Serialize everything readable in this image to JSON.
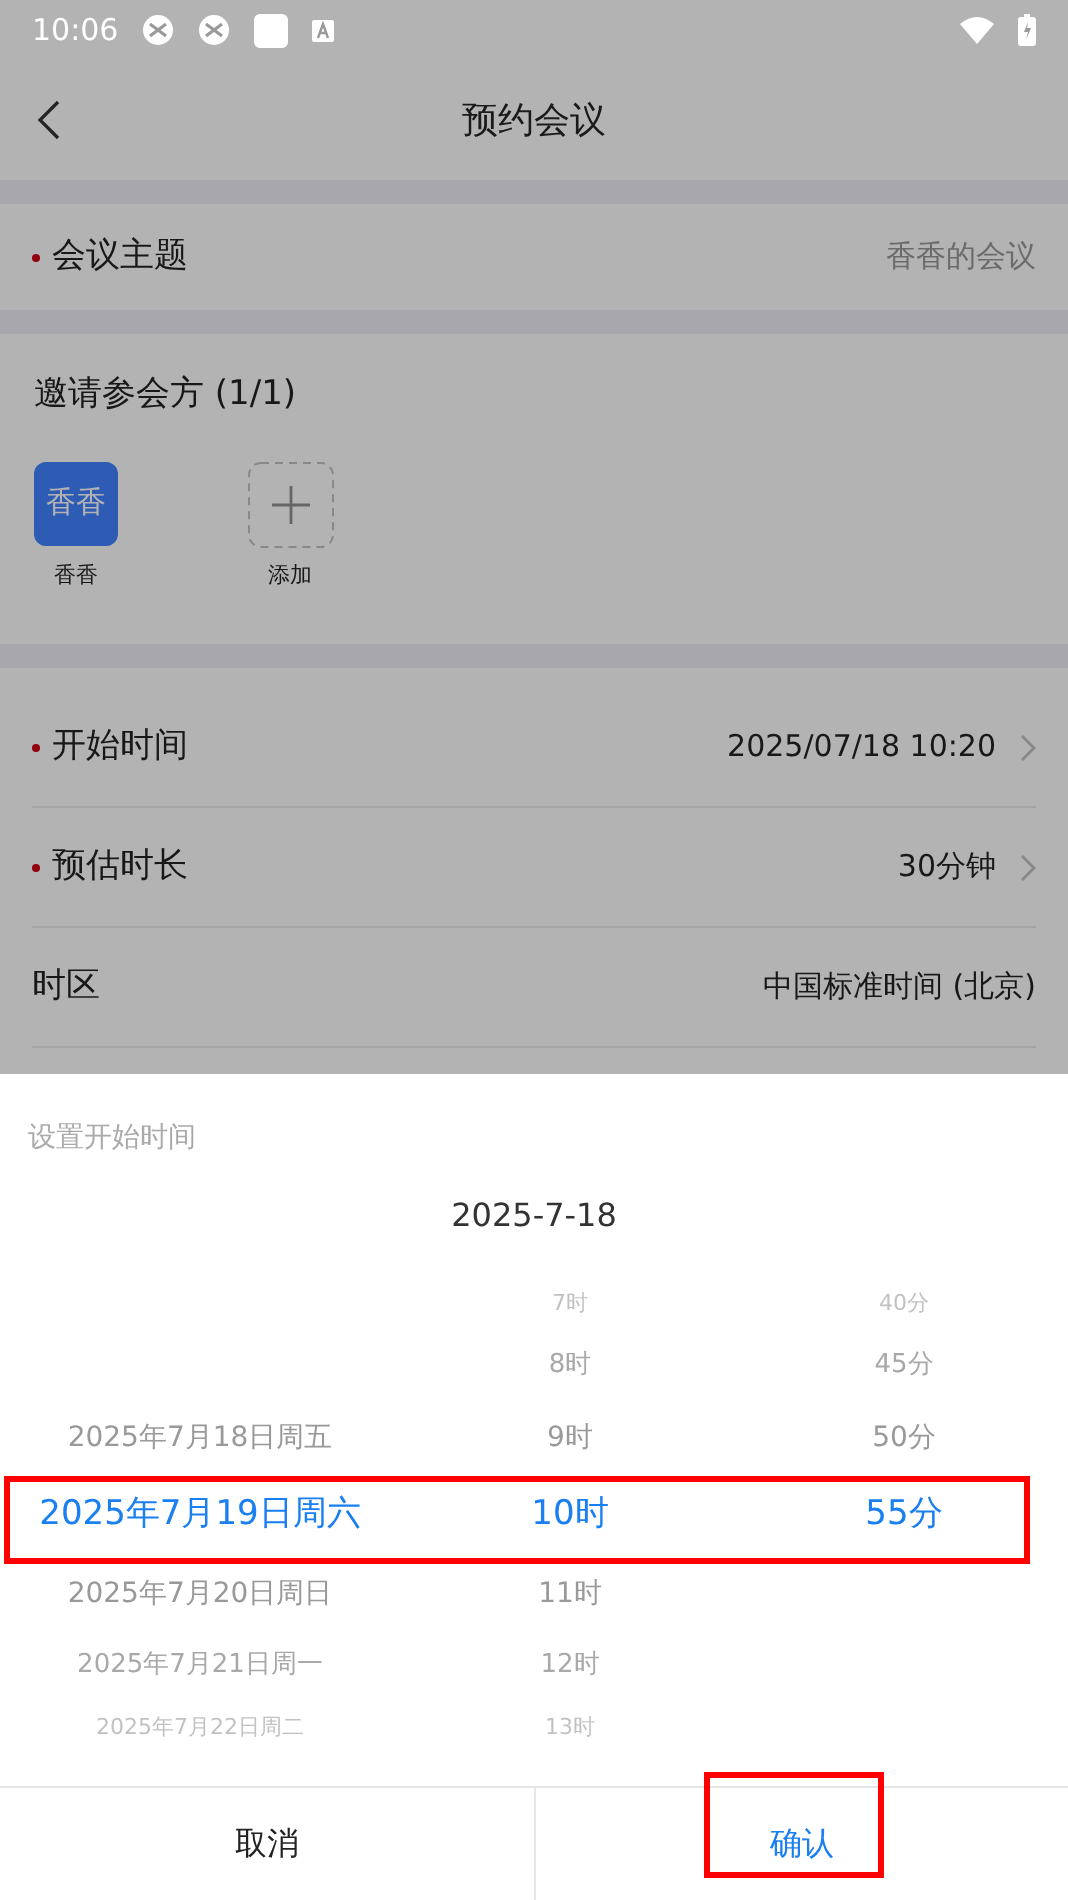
{
  "status_bar": {
    "time": "10:06"
  },
  "header": {
    "title": "预约会议"
  },
  "topic": {
    "label": "会议主题",
    "required": true,
    "value": "香香的会议"
  },
  "invitees": {
    "label": "邀请参会方 (1/1)",
    "people": [
      {
        "avatar_text": "香香",
        "name": "香香"
      }
    ],
    "add_label": "添加"
  },
  "settings": [
    {
      "label": "开始时间",
      "required": true,
      "value": "2025/07/18 10:20",
      "chevron": true
    },
    {
      "label": "预估时长",
      "required": true,
      "value": "30分钟",
      "chevron": true
    },
    {
      "label": "时区",
      "required": false,
      "value": "中国标准时间 (北京)",
      "chevron": false
    }
  ],
  "sheet": {
    "title": "设置开始时间",
    "date": "2025-7-18",
    "selection_row_highlighted": true,
    "columns": [
      {
        "kind": "date",
        "items": [
          {
            "label": "2025年7月18日周五",
            "selected": false
          },
          {
            "label": "2025年7月19日周六",
            "selected": true
          },
          {
            "label": "2025年7月20日周日",
            "selected": false
          },
          {
            "label": "2025年7月21日周一",
            "selected": false
          },
          {
            "label": "2025年7月22日周二",
            "selected": false
          }
        ]
      },
      {
        "kind": "hour",
        "items": [
          {
            "label": "7时",
            "selected": false
          },
          {
            "label": "8时",
            "selected": false
          },
          {
            "label": "9时",
            "selected": false
          },
          {
            "label": "10时",
            "selected": true
          },
          {
            "label": "11时",
            "selected": false
          },
          {
            "label": "12时",
            "selected": false
          },
          {
            "label": "13时",
            "selected": false
          }
        ]
      },
      {
        "kind": "minute",
        "items": [
          {
            "label": "40分",
            "selected": false
          },
          {
            "label": "45分",
            "selected": false
          },
          {
            "label": "50分",
            "selected": false
          },
          {
            "label": "55分",
            "selected": true
          }
        ]
      }
    ],
    "buttons": [
      {
        "label": "取消",
        "kind": "cancel",
        "highlighted": false
      },
      {
        "label": "确认",
        "kind": "confirm",
        "highlighted": true
      }
    ]
  }
}
